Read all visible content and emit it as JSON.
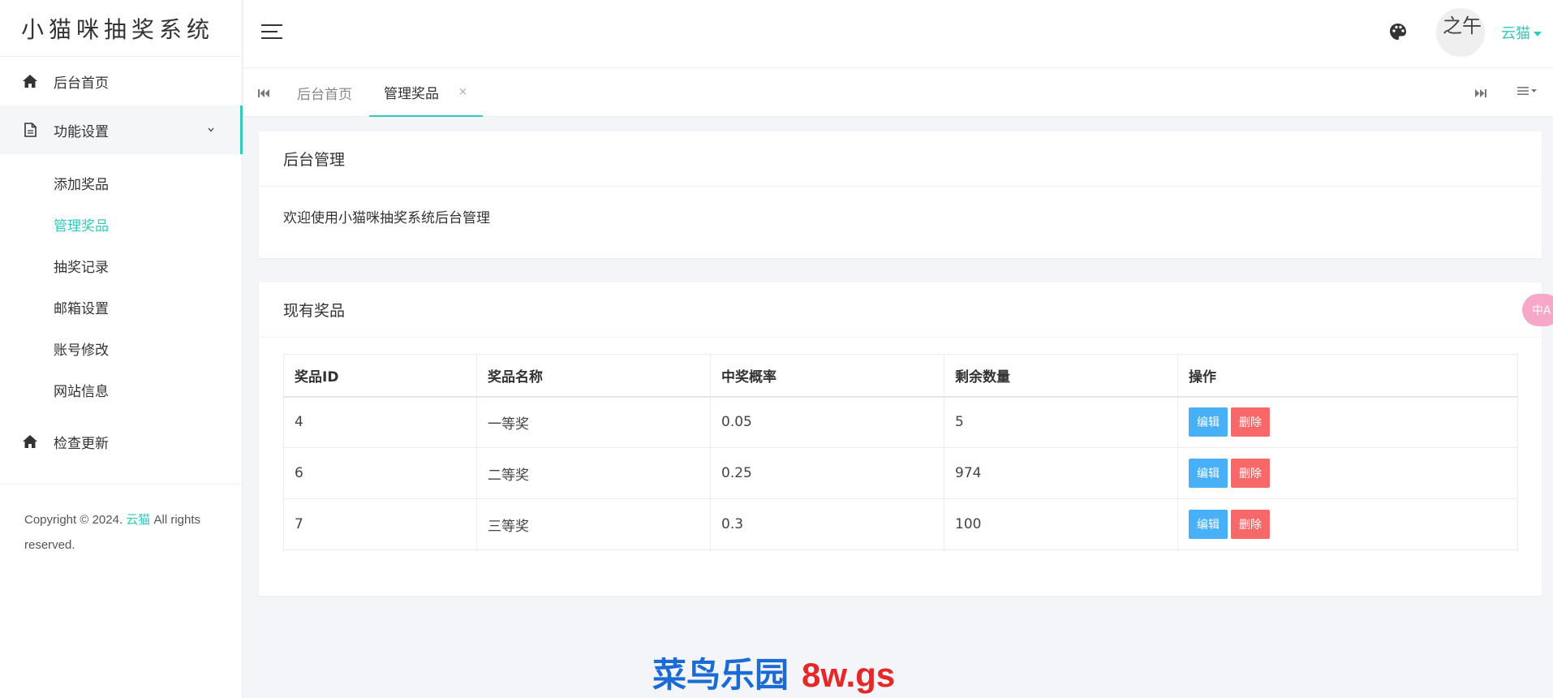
{
  "app": {
    "title": "小猫咪抽奖系统"
  },
  "sidebar": {
    "home_label": "后台首页",
    "settings_label": "功能设置",
    "sub_items": [
      {
        "label": "添加奖品"
      },
      {
        "label": "管理奖品"
      },
      {
        "label": "抽奖记录"
      },
      {
        "label": "邮箱设置"
      },
      {
        "label": "账号修改"
      },
      {
        "label": "网站信息"
      }
    ],
    "update_label": "检查更新",
    "copyright_pre": "Copyright © 2024. ",
    "copyright_brand": "云猫",
    "copyright_post": " All rights reserved."
  },
  "header": {
    "menu_icon": "hamburger-icon",
    "theme_icon": "palette-icon",
    "avatar_text": "之午",
    "username": "云猫"
  },
  "tabs": {
    "home": "后台首页",
    "current": "管理奖品",
    "close": "×"
  },
  "card_admin": {
    "title": "后台管理",
    "welcome": "欢迎使用小猫咪抽奖系统后台管理"
  },
  "card_prizes": {
    "title": "现有奖品",
    "columns": [
      "奖品ID",
      "奖品名称",
      "中奖概率",
      "剩余数量",
      "操作"
    ],
    "rows": [
      {
        "id": "4",
        "name": "一等奖",
        "rate": "0.05",
        "remain": "5"
      },
      {
        "id": "6",
        "name": "二等奖",
        "rate": "0.25",
        "remain": "974"
      },
      {
        "id": "7",
        "name": "三等奖",
        "rate": "0.3",
        "remain": "100"
      }
    ],
    "edit_label": "编辑",
    "delete_label": "删除"
  },
  "translate_badge": "中A",
  "watermark": {
    "cn": "菜鸟乐园",
    "en": "8w.gs"
  },
  "colors": {
    "accent": "#33cabb",
    "edit": "#48b0f7",
    "delete": "#f96868",
    "background": "#f4f5f9"
  }
}
